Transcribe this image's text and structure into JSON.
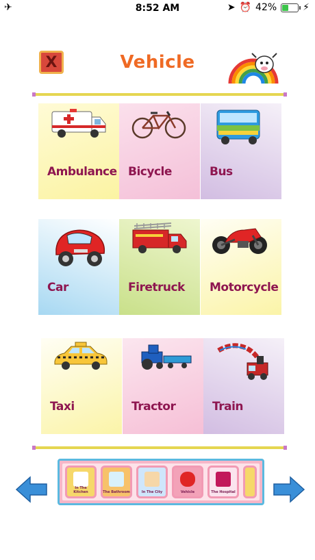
{
  "status_bar": {
    "time": "8:52 AM",
    "battery": "42%",
    "battery_level": 0.42
  },
  "header": {
    "title": "Vehicle",
    "close_label": "X"
  },
  "vehicles": [
    {
      "label": "Ambulance"
    },
    {
      "label": "Bicycle"
    },
    {
      "label": "Bus"
    },
    {
      "label": "Car"
    },
    {
      "label": "Firetruck"
    },
    {
      "label": "Motorcycle"
    },
    {
      "label": "Taxi"
    },
    {
      "label": "Tractor"
    },
    {
      "label": "Train"
    }
  ],
  "categories": [
    {
      "label": "In The Kitchen"
    },
    {
      "label": "The Bathroom"
    },
    {
      "label": "In The City"
    },
    {
      "label": "Vehicle"
    },
    {
      "label": "The Hospital"
    }
  ],
  "colors": {
    "title": "#ef6a24",
    "label": "#8e1650",
    "divider": "#e5d651",
    "strip_border": "#5bb9e0",
    "arrow": "#3a8fd8"
  }
}
